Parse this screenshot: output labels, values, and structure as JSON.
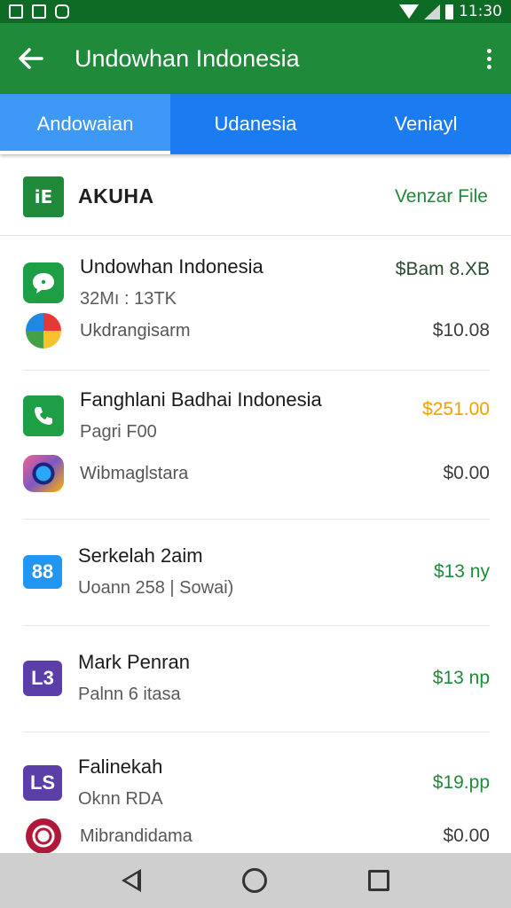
{
  "status_bar": {
    "time": "11:30",
    "left_icons": [
      "image-icon",
      "photo-icon",
      "shield-icon"
    ],
    "right_icons": [
      "wifi-icon",
      "signal-icon",
      "battery-icon"
    ]
  },
  "app_bar": {
    "title": "Undowhan Indonesia",
    "back_icon": "arrow-left-icon",
    "menu_icon": "more-vertical-icon"
  },
  "tabs": [
    {
      "label": "Andowaian",
      "active": true
    },
    {
      "label": "Udanesia",
      "active": false
    },
    {
      "label": "Veniayl",
      "active": false
    }
  ],
  "section": {
    "icon_text": "iE",
    "title": "AKUHA",
    "link": "Venzar File"
  },
  "items": [
    {
      "icon_text": "…",
      "icon_color": "green",
      "name": "Undowhan Indonesia",
      "sub": "32Mı : 13TK",
      "price": "$Bam 8.XB",
      "price_color": "dark",
      "subitem": {
        "name": "Ukdrangisarm",
        "price": "$10.08",
        "icon": "pinwheel-icon"
      }
    },
    {
      "icon_text": "☎",
      "icon_color": "green",
      "name": "Fanghlani Badhai Indonesia",
      "sub": "Pagri F00",
      "price": "$251.00",
      "price_color": "orange",
      "subitem": {
        "name": "Wibmaglstara",
        "price": "$0.00",
        "icon": "camera-icon"
      }
    },
    {
      "icon_text": "88",
      "icon_color": "blue",
      "name": "Serkelah 2aim",
      "sub": "Uoann 258 | Sowai)",
      "price": "$13 ny",
      "price_color": "green"
    },
    {
      "icon_text": "L3",
      "icon_color": "purple",
      "name": "Mark Penran",
      "sub": "Palnn 6 itasa",
      "price": "$13 np",
      "price_color": "green"
    },
    {
      "icon_text": "LS",
      "icon_color": "purple",
      "name": "Falinekah",
      "sub": "Oknn RDA",
      "price": "$19.pp",
      "price_color": "green",
      "subitem": {
        "name": "Mibrandidama",
        "price": "$0.00",
        "icon": "instagram-icon"
      }
    }
  ],
  "nav_bar": {
    "icons": [
      "nav-back-icon",
      "nav-home-icon",
      "nav-recents-icon"
    ]
  }
}
